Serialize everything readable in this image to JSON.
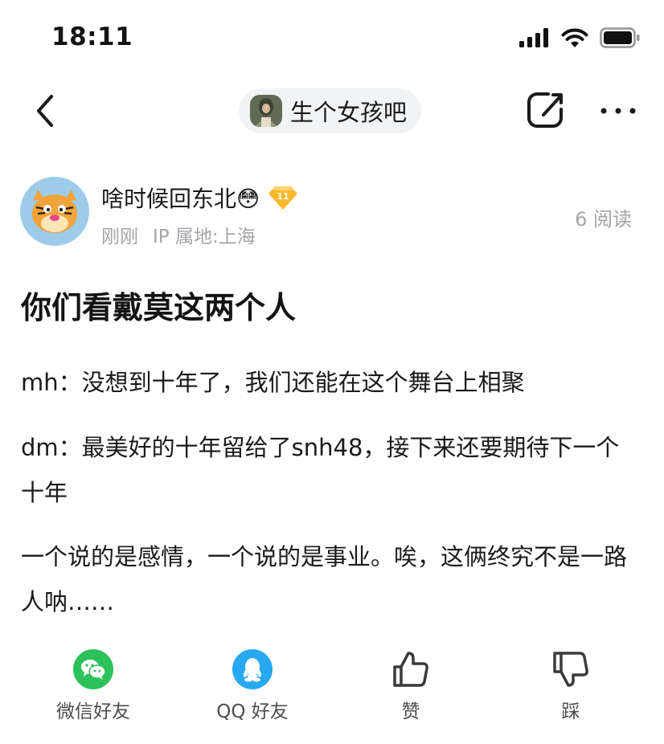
{
  "status_bar": {
    "time": "18:11"
  },
  "nav": {
    "forum_name": "生个女孩吧"
  },
  "author": {
    "name": "啥时候回东北😳",
    "level": "11",
    "time": "刚刚",
    "ip": "IP 属地:上海",
    "reads": "6 阅读"
  },
  "post": {
    "title": "你们看戴莫这两个人",
    "paragraphs": [
      "mh：没想到十年了，我们还能在这个舞台上相聚",
      "dm：最美好的十年留给了snh48，接下来还要期待下一个十年",
      "一个说的是感情，一个说的是事业。唉，这俩终究不是一路人呐……"
    ]
  },
  "actions": {
    "wechat": "微信好友",
    "qq": "QQ 好友",
    "like": "赞",
    "dislike": "踩"
  },
  "colors": {
    "wechat": "#2dc15c",
    "qq": "#27a8f0",
    "level_badge": "#f8b92d"
  }
}
